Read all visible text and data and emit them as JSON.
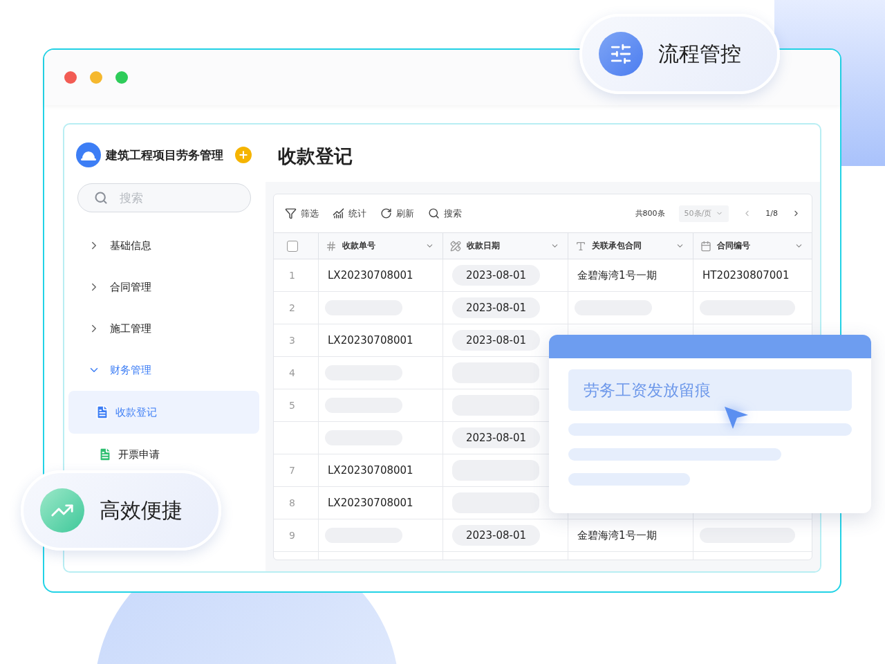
{
  "feature_badges": [
    {
      "kind": "process",
      "label": "流程管控"
    },
    {
      "kind": "efficiency",
      "label": "高效便捷"
    }
  ],
  "sidebar": {
    "app_title": "建筑工程项目劳务管理",
    "search": {
      "placeholder": "搜索"
    },
    "items": [
      {
        "label": "基础信息",
        "expanded": false
      },
      {
        "label": "合同管理",
        "expanded": false
      },
      {
        "label": "施工管理",
        "expanded": false
      },
      {
        "label": "财务管理",
        "expanded": true,
        "children": [
          {
            "label": "收款登记",
            "selected": true
          },
          {
            "label": "开票申请",
            "selected": false
          }
        ]
      }
    ]
  },
  "page_title": "收款登记",
  "toolbar": {
    "actions": [
      {
        "kind": "filter",
        "label": "筛选"
      },
      {
        "kind": "stats",
        "label": "统计"
      },
      {
        "kind": "refresh",
        "label": "刷新"
      },
      {
        "kind": "search",
        "label": "搜索"
      }
    ],
    "total": "共800条",
    "page_size": "50条/页",
    "page": "1/8"
  },
  "table": {
    "select_all": {
      "checked": false
    },
    "columns": [
      {
        "kind": "number",
        "label": "收款单号"
      },
      {
        "kind": "date",
        "label": "收款日期"
      },
      {
        "kind": "text",
        "label": "关联承包合同"
      },
      {
        "kind": "calendar",
        "label": "合同编号"
      }
    ],
    "rows": [
      {
        "number": "1",
        "cells": [
          {
            "kind": "text",
            "text": "LX20230708001"
          },
          {
            "kind": "chip",
            "text": "2023-08-01"
          },
          {
            "kind": "text",
            "text": "金碧海湾1号一期"
          },
          {
            "kind": "text",
            "text": "HT20230807001"
          }
        ]
      },
      {
        "number": "2",
        "cells": [
          {
            "kind": "skeleton"
          },
          {
            "kind": "chip",
            "text": "2023-08-01"
          },
          {
            "kind": "skeleton"
          },
          {
            "kind": "skeleton"
          }
        ]
      },
      {
        "number": "3",
        "cells": [
          {
            "kind": "text",
            "text": "LX20230708001"
          },
          {
            "kind": "chip",
            "text": "2023-08-01"
          }
        ]
      },
      {
        "number": "4",
        "cells": [
          {
            "kind": "skeleton"
          },
          {
            "kind": "skeleton"
          }
        ]
      },
      {
        "number": "5",
        "cells": [
          {
            "kind": "skeleton"
          },
          {
            "kind": "skeleton"
          }
        ]
      },
      {
        "cells": [
          {
            "kind": "skeleton"
          },
          {
            "kind": "chip",
            "text": "2023-08-01"
          }
        ]
      },
      {
        "number": "7",
        "cells": [
          {
            "kind": "text",
            "text": "LX20230708001"
          },
          {
            "kind": "skeleton"
          }
        ]
      },
      {
        "number": "8",
        "cells": [
          {
            "kind": "text",
            "text": "LX20230708001"
          },
          {
            "kind": "skeleton"
          }
        ]
      },
      {
        "number": "9",
        "cells": [
          {
            "kind": "skeleton"
          },
          {
            "kind": "chip",
            "text": "2023-08-01"
          },
          {
            "kind": "text",
            "text": "金碧海湾1号一期"
          },
          {
            "kind": "skeleton"
          }
        ]
      }
    ]
  },
  "popup": {
    "title": "劳务工资发放留痕"
  }
}
